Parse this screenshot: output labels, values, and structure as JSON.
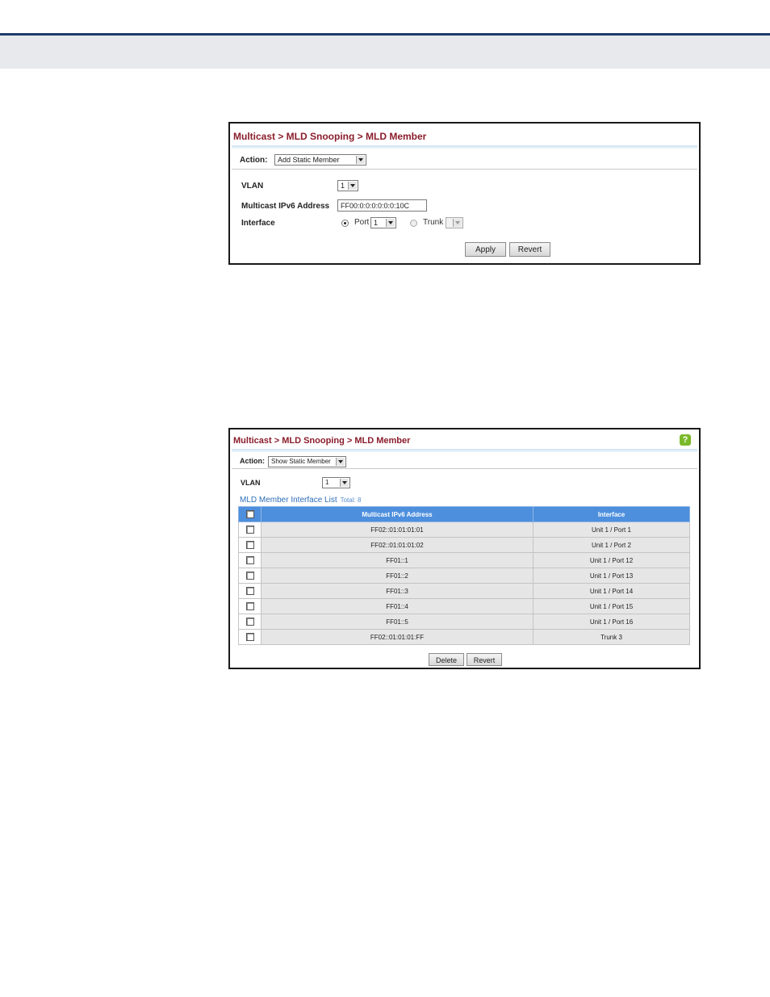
{
  "panel1": {
    "breadcrumb": "Multicast > MLD Snooping > MLD Member",
    "action_label": "Action:",
    "action_value": "Add Static Member",
    "vlan_label": "VLAN",
    "vlan_value": "1",
    "ipv6_label": "Multicast IPv6 Address",
    "ipv6_value": "FF00:0:0:0:0:0:0:10C",
    "interface_label": "Interface",
    "port_label": "Port",
    "port_value": "1",
    "trunk_label": "Trunk",
    "trunk_value": "",
    "apply_label": "Apply",
    "revert_label": "Revert"
  },
  "panel2": {
    "breadcrumb": "Multicast > MLD Snooping > MLD Member",
    "help_icon": "?",
    "action_label": "Action:",
    "action_value": "Show Static Member",
    "vlan_label": "VLAN",
    "vlan_value": "1",
    "list_title": "MLD Member Interface List",
    "total": "Total: 8",
    "columns": [
      "Multicast IPv6 Address",
      "Interface"
    ],
    "rows": [
      {
        "address": "FF02::01:01:01:01",
        "interface": "Unit 1 / Port 1"
      },
      {
        "address": "FF02::01:01:01:02",
        "interface": "Unit 1 / Port 2"
      },
      {
        "address": "FF01::1",
        "interface": "Unit 1 / Port 12"
      },
      {
        "address": "FF01::2",
        "interface": "Unit 1 / Port 13"
      },
      {
        "address": "FF01::3",
        "interface": "Unit 1 / Port 14"
      },
      {
        "address": "FF01::4",
        "interface": "Unit 1 / Port 15"
      },
      {
        "address": "FF01::5",
        "interface": "Unit 1 / Port 16"
      },
      {
        "address": "FF02::01:01:01:FF",
        "interface": "Trunk 3"
      }
    ],
    "delete_label": "Delete",
    "revert_label": "Revert"
  },
  "colors": {
    "breadcrumb": "#8b1d2c",
    "table_header": "#4d8fdd",
    "top_rule": "#1c3b6e",
    "top_band": "#e8e9ec"
  }
}
